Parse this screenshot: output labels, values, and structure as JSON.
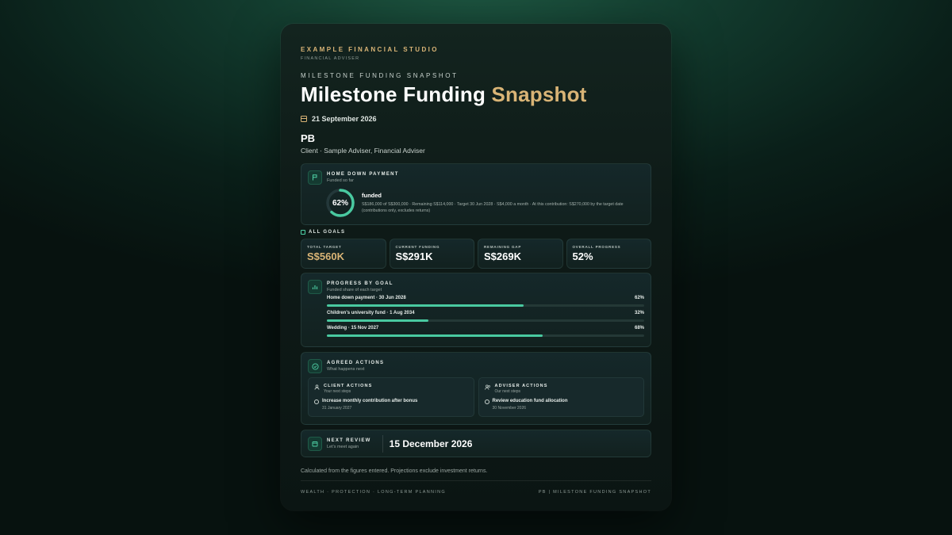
{
  "header": {
    "studio_name": "EXAMPLE FINANCIAL STUDIO",
    "studio_role": "FINANCIAL ADVISER",
    "eyebrow": "MILESTONE FUNDING SNAPSHOT",
    "title_main": "Milestone Funding ",
    "title_accent": "Snapshot",
    "date": "21 September 2026"
  },
  "client": {
    "initials": "PB",
    "role_line": "Client · Sample Adviser, Financial Adviser"
  },
  "featured_goal": {
    "title": "HOME DOWN PAYMENT",
    "subtitle": "Funded so far",
    "percent_label": "62%",
    "percent": 62,
    "funded_label": "funded",
    "detail": "S$186,000 of S$300,000 · Remaining S$114,000 · Target 30 Jun 2028 · S$4,000 a month · At this contribution: S$270,000 by the target date (contributions only, excludes returns)"
  },
  "all_goals": {
    "label": "ALL GOALS",
    "stats": [
      {
        "label": "TOTAL TARGET",
        "value": "S$560K",
        "gold": true
      },
      {
        "label": "CURRENT FUNDING",
        "value": "S$291K",
        "gold": false
      },
      {
        "label": "REMAINING GAP",
        "value": "S$269K",
        "gold": false
      },
      {
        "label": "OVERALL PROGRESS",
        "value": "52%",
        "gold": false
      }
    ]
  },
  "progress": {
    "title": "PROGRESS BY GOAL",
    "subtitle": "Funded share of each target",
    "goals": [
      {
        "name": "Home down payment · 30 Jun 2028",
        "pct_label": "62%",
        "pct": 62
      },
      {
        "name": "Children's university fund · 1 Aug 2034",
        "pct_label": "32%",
        "pct": 32
      },
      {
        "name": "Wedding · 15 Nov 2027",
        "pct_label": "68%",
        "pct": 68
      }
    ]
  },
  "actions": {
    "title": "AGREED ACTIONS",
    "subtitle": "What happens next",
    "client": {
      "title": "CLIENT ACTIONS",
      "subtitle": "Your next steps",
      "item_title": "Increase monthly contribution after bonus",
      "item_date": "31 January 2027"
    },
    "adviser": {
      "title": "ADVISER ACTIONS",
      "subtitle": "Our next steps",
      "item_title": "Review education fund allocation",
      "item_date": "30 November 2026"
    }
  },
  "review": {
    "title": "NEXT REVIEW",
    "subtitle": "Let's meet again",
    "date": "15 December 2026"
  },
  "footnote": "Calculated from the figures entered. Projections exclude investment returns.",
  "footer": {
    "left": "WEALTH · PROTECTION · LONG-TERM PLANNING",
    "right": "PB | MILESTONE FUNDING SNAPSHOT"
  },
  "colors": {
    "accent_gold": "#d9b476",
    "accent_green": "#49c9a0"
  }
}
